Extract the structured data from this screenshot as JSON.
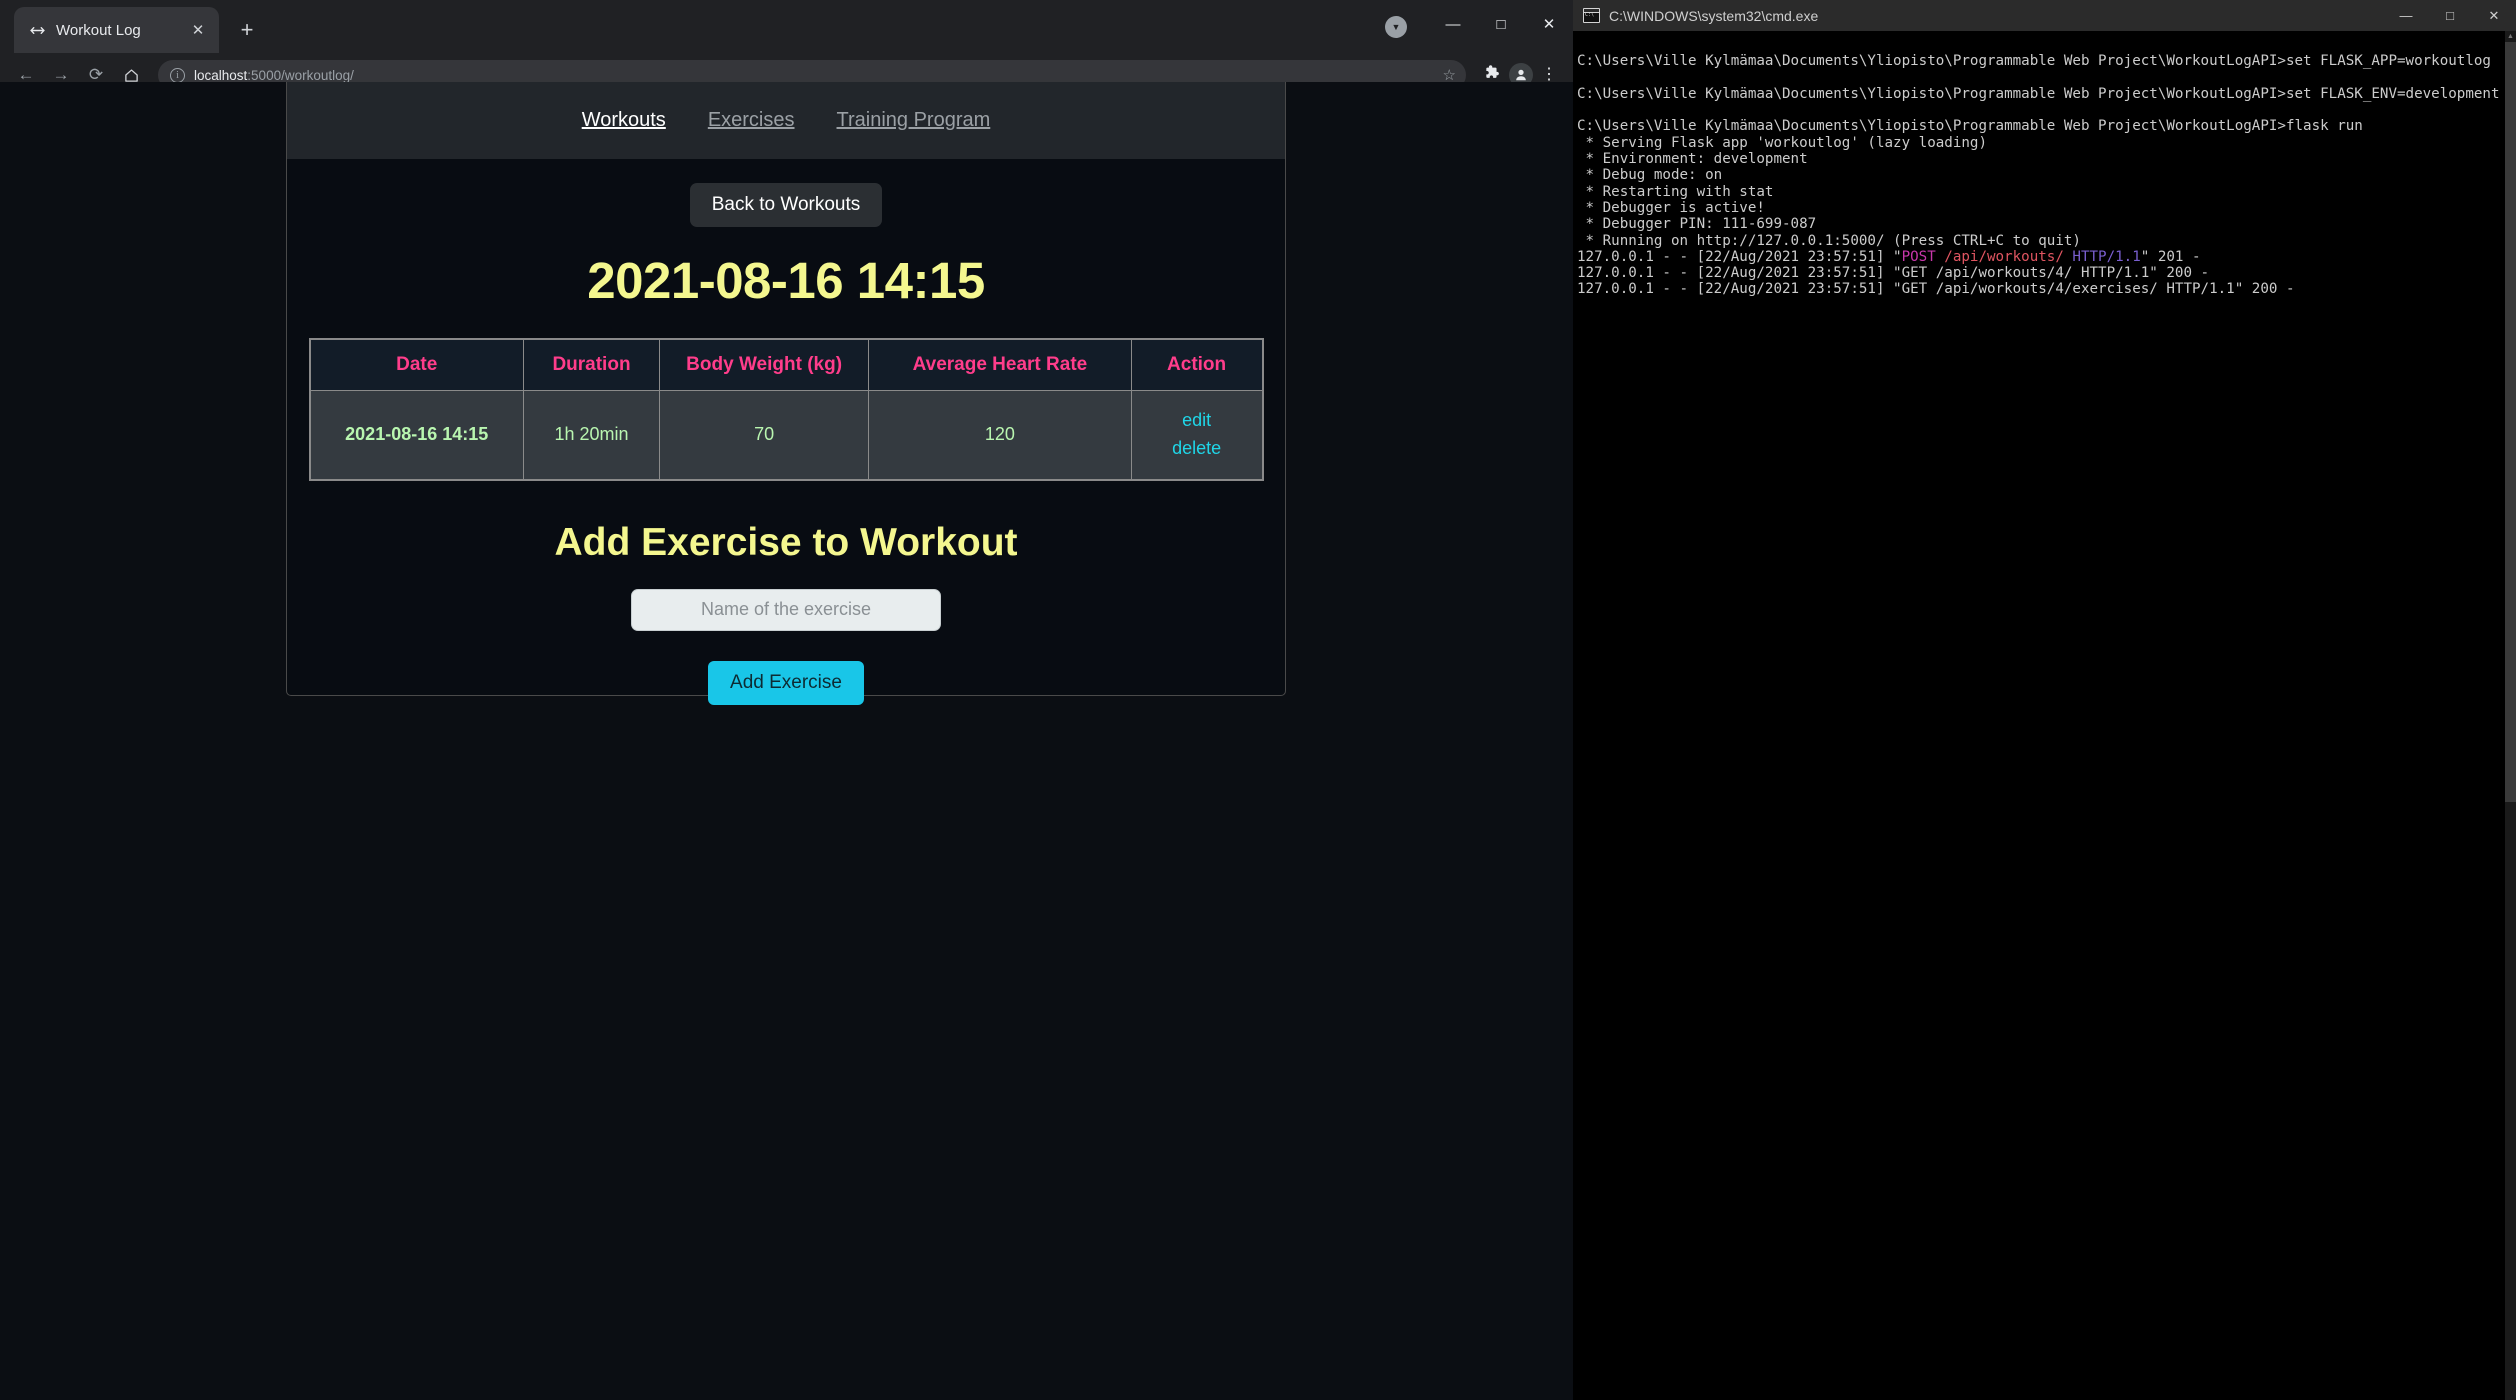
{
  "browser": {
    "tab": {
      "favicon": "dumbbell-icon",
      "title": "Workout Log",
      "close_glyph": "✕"
    },
    "new_tab_glyph": "+",
    "window_controls": {
      "download_glyph": "▼",
      "minimize": "—",
      "maximize": "□",
      "close": "✕"
    },
    "toolbar": {
      "back": "←",
      "forward": "→",
      "reload": "⟳",
      "home": "⌂",
      "site_info": "ⓘ",
      "url_host": "localhost",
      "url_rest": ":5000/workoutlog/",
      "bookmark_star": "☆",
      "extensions": "🧩",
      "profile": "👤",
      "menu": "⋮"
    }
  },
  "page": {
    "nav": {
      "items": [
        {
          "label": "Workouts",
          "active": true
        },
        {
          "label": "Exercises",
          "active": false
        },
        {
          "label": "Training Program",
          "active": false
        }
      ]
    },
    "back_button_label": "Back to Workouts",
    "title": "2021-08-16 14:15",
    "table": {
      "headers": [
        "Date",
        "Duration",
        "Body Weight (kg)",
        "Average Heart Rate",
        "Action"
      ],
      "rows": [
        {
          "date": "2021-08-16 14:15",
          "duration": "1h 20min",
          "body_weight": "70",
          "avg_heart_rate": "120",
          "edit_label": "edit",
          "delete_label": "delete"
        }
      ]
    },
    "add_exercise": {
      "heading": "Add Exercise to Workout",
      "input_value": "",
      "input_placeholder": "Name of the exercise",
      "button_label": "Add Exercise"
    },
    "colors": {
      "title_yellow": "#f4f78f",
      "header_pink": "#ff3d8b",
      "cell_green": "#b9f6b0",
      "link_cyan": "#1fd6e8",
      "accent_cyan": "#19c6e8"
    }
  },
  "terminal": {
    "title": "C:\\WINDOWS\\system32\\cmd.exe",
    "window_controls": {
      "minimize": "—",
      "maximize": "□",
      "close": "✕"
    },
    "lines": [
      {
        "text": ""
      },
      {
        "text": "C:\\Users\\Ville Kylmämaa\\Documents\\Yliopisto\\Programmable Web Project\\WorkoutLogAPI>set FLASK_APP=workoutlog"
      },
      {
        "text": ""
      },
      {
        "text": "C:\\Users\\Ville Kylmämaa\\Documents\\Yliopisto\\Programmable Web Project\\WorkoutLogAPI>set FLASK_ENV=development"
      },
      {
        "text": ""
      },
      {
        "text": "C:\\Users\\Ville Kylmämaa\\Documents\\Yliopisto\\Programmable Web Project\\WorkoutLogAPI>flask run"
      },
      {
        "text": " * Serving Flask app 'workoutlog' (lazy loading)"
      },
      {
        "text": " * Environment: development"
      },
      {
        "text": " * Debug mode: on"
      },
      {
        "text": " * Restarting with stat"
      },
      {
        "text": " * Debugger is active!"
      },
      {
        "text": " * Debugger PIN: 111-699-087"
      },
      {
        "text": " * Running on http://127.0.0.1:5000/ (Press CTRL+C to quit)"
      }
    ],
    "log_post": {
      "prefix": "127.0.0.1 - - [22/Aug/2021 23:57:51] \"",
      "method": "POST",
      "path": " /api/workouts/",
      "proto": " HTTP/1.1",
      "suffix": "\" 201 -"
    },
    "log_plain": [
      "127.0.0.1 - - [22/Aug/2021 23:57:51] \"GET /api/workouts/4/ HTTP/1.1\" 200 -",
      "127.0.0.1 - - [22/Aug/2021 23:57:51] \"GET /api/workouts/4/exercises/ HTTP/1.1\" 200 -"
    ],
    "scroll_up_glyph": "▲",
    "scroll_down_glyph": "▼"
  }
}
